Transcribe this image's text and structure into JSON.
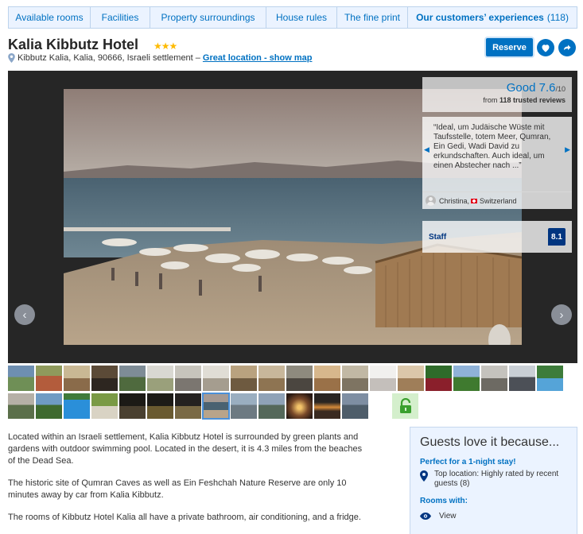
{
  "tabs": [
    {
      "label": "Available rooms"
    },
    {
      "label": "Facilities"
    },
    {
      "label": "Property surroundings"
    },
    {
      "label": "House rules"
    },
    {
      "label": "The fine print"
    },
    {
      "label": "Our customers’ experiences",
      "count": "(118)"
    }
  ],
  "header": {
    "title": "Kalia Kibbutz Hotel",
    "stars": "★★★",
    "address": "Kibbutz Kalia, Kalia, 90666, Israeli settlement –",
    "location_link": "Great location - show map",
    "reserve_label": "Reserve",
    "heart_icon": "heart-icon",
    "share_icon": "share-icon"
  },
  "gallery": {
    "prev_glyph": "‹",
    "next_glyph": "›",
    "rating_word": "Good",
    "rating_value": "7.6",
    "rating_scale": "/10",
    "reviews_prefix": "from",
    "reviews_bold": "118 trusted reviews",
    "review_quote": "“Ideal, um Judäische Wüste mit Taufsstelle, totem Meer, Qumran, Ein Gedi, Wadi David zu erkundschaften. Auch ideal, um einen Abstecher nach ...”",
    "reviewer_name": "Christina,",
    "reviewer_country": "Switzerland",
    "staff_label": "Staff",
    "staff_score": "8.1"
  },
  "description": [
    "Located within an Israeli settlement, Kalia Kibbutz Hotel is surrounded by green plants and gardens with outdoor swimming pool. Located in the desert, it is 4.3 miles from the beaches of the Dead Sea.",
    "The historic site of Qumran Caves as well as Ein Feshchah Nature Reserve are only 10 minutes away by car from Kalia Kibbutz.",
    "The rooms of Kibbutz Hotel Kalia all have a private bathroom, air conditioning, and a fridge."
  ],
  "guests_love": {
    "title": "Guests love it because...",
    "perfect_label": "Perfect for a 1-night stay!",
    "top_location": "Top location: Highly rated by recent guests (8)",
    "rooms_with_label": "Rooms with:",
    "view_label": "View"
  },
  "colors": {
    "accent": "#0071c2",
    "navy": "#003580",
    "star": "#febb02"
  }
}
